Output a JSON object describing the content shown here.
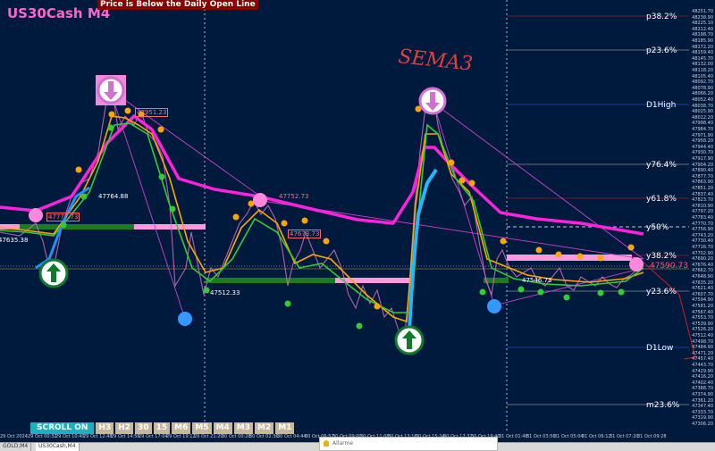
{
  "window": {
    "title": "US30Cash M4",
    "banner": "Price is Below the Daily Open Line",
    "handwritten_note": "SEMA3"
  },
  "colors": {
    "background": "#001a3d",
    "title": "#ff66cc",
    "banner_bg": "#8a0000",
    "ema_slow": "#ff22dd",
    "ema_mid": "#ffa500",
    "ema_fast": "#33cc33",
    "ema_blue": "#2299ff",
    "price": "#d070c0",
    "fib_line": "#c0c0c0",
    "d1_line": "#1144cc",
    "resistance_zone": "#ff99dd",
    "support_zone": "#228b22",
    "current_price": "#ff4d6d"
  },
  "price_axis": [
    "48251.70",
    "48238.90",
    "48225.10",
    "48212.40",
    "48198.70",
    "48185.90",
    "48172.20",
    "48159.40",
    "48145.70",
    "48132.00",
    "48118.20",
    "48105.40",
    "48092.70",
    "48078.90",
    "48066.20",
    "48052.40",
    "48038.70",
    "48025.90",
    "48012.20",
    "47998.40",
    "47984.70",
    "47971.90",
    "47958.20",
    "47944.40",
    "47930.70",
    "47917.90",
    "47904.20",
    "47890.40",
    "47877.70",
    "47863.90",
    "47851.20",
    "47837.40",
    "47823.70",
    "47810.90",
    "47797.20",
    "47783.40",
    "47770.70",
    "47756.90",
    "47743.20",
    "47730.40",
    "47716.70",
    "47702.90",
    "47690.20",
    "47676.40",
    "47662.70",
    "47648.90",
    "47635.20",
    "47621.40",
    "47607.70",
    "47594.90",
    "47581.20",
    "47567.40",
    "47553.70",
    "47539.90",
    "47526.20",
    "47512.40",
    "47498.70",
    "47484.90",
    "47471.20",
    "47457.40",
    "47443.70",
    "47429.90",
    "47416.20",
    "47402.40",
    "47388.70",
    "47374.90",
    "47361.20",
    "47347.40",
    "47333.70",
    "47319.90",
    "47306.20"
  ],
  "fib_levels": [
    {
      "label": "p38.2%"
    },
    {
      "label": "p23.6%"
    },
    {
      "label": "D1High"
    },
    {
      "label": "y76.4%"
    },
    {
      "label": "y61.8%"
    },
    {
      "label": "y50%"
    },
    {
      "label": "y38.2%"
    },
    {
      "label": "y23.6%"
    },
    {
      "label": "D1Low"
    },
    {
      "label": "m23.6%"
    }
  ],
  "price_labels": [
    {
      "text": "47777.73"
    },
    {
      "text": "47635.38"
    },
    {
      "text": "47764.88"
    },
    {
      "text": "47951.23"
    },
    {
      "text": "47752.73"
    },
    {
      "text": "47673.73"
    },
    {
      "text": "47512.33"
    },
    {
      "text": "47546.73"
    }
  ],
  "current_price": "47590.73",
  "timeframe_bar": {
    "scroll_label": "SCROLL ON",
    "buttons": [
      "H3",
      "H2",
      "30",
      "15",
      "M6",
      "M5",
      "M4",
      "M3",
      "M2",
      "M1"
    ]
  },
  "time_axis": [
    "29 Oct 2024",
    "29 Oct 00:32",
    "29 Oct 10:40",
    "29 Oct 12:48",
    "29 Oct 14:56",
    "29 Oct 17:04",
    "29 Oct 19:12",
    "29 Oct 21:20",
    "30 Oct 00:28",
    "30 Oct 02:36",
    "30 Oct 04:44",
    "30 Oct 06:52",
    "30 Oct 09:00",
    "30 Oct 11:08",
    "30 Oct 13:16",
    "30 Oct 15:24",
    "30 Oct 17:32",
    "30 Oct 19:40",
    "31 Oct 01:48",
    "31 Oct 03:56",
    "31 Oct 05:04",
    "31 Oct 06:12",
    "31 Oct 07:20",
    "31 Oct 09:28"
  ],
  "tabs": [
    "GOLD,M4",
    "US30Cash,M4"
  ],
  "active_tab": 1,
  "alarm_title": "Allarme"
}
